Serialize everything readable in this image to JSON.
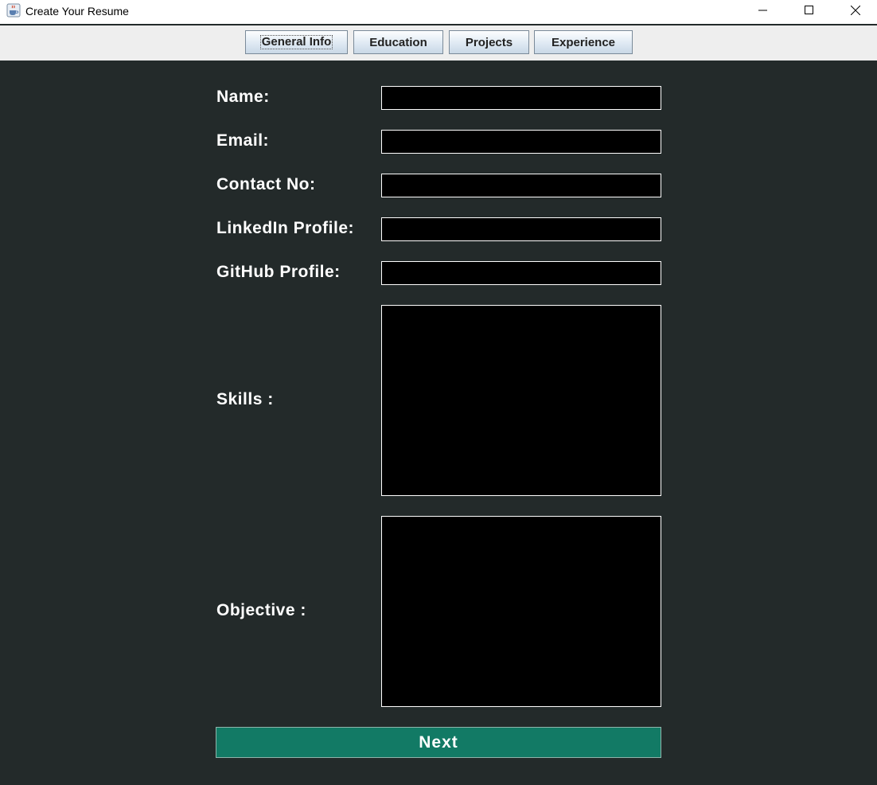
{
  "window": {
    "title": "Create Your Resume",
    "icon": "java-cup-icon",
    "controls": [
      "minimize-icon",
      "maximize-icon",
      "close-icon"
    ]
  },
  "tabs": [
    {
      "label": "General Info",
      "selected": true
    },
    {
      "label": "Education",
      "selected": false
    },
    {
      "label": "Projects",
      "selected": false
    },
    {
      "label": "Experience",
      "selected": false
    }
  ],
  "form": {
    "name": {
      "label": "Name:",
      "value": ""
    },
    "email": {
      "label": "Email:",
      "value": ""
    },
    "contact": {
      "label": "Contact No:",
      "value": ""
    },
    "linkedin": {
      "label": "LinkedIn Profile:",
      "value": ""
    },
    "github": {
      "label": "GitHub Profile:",
      "value": ""
    },
    "skills": {
      "label": "Skills :",
      "value": ""
    },
    "objective": {
      "label": "Objective :",
      "value": ""
    }
  },
  "next_button": {
    "label": "Next"
  },
  "colors": {
    "background": "#232a2a",
    "field_background": "#000000",
    "field_border": "#ffffff",
    "label_text": "#ffffff",
    "next_button": "#127a65",
    "tab_strip": "#eeeeee"
  }
}
